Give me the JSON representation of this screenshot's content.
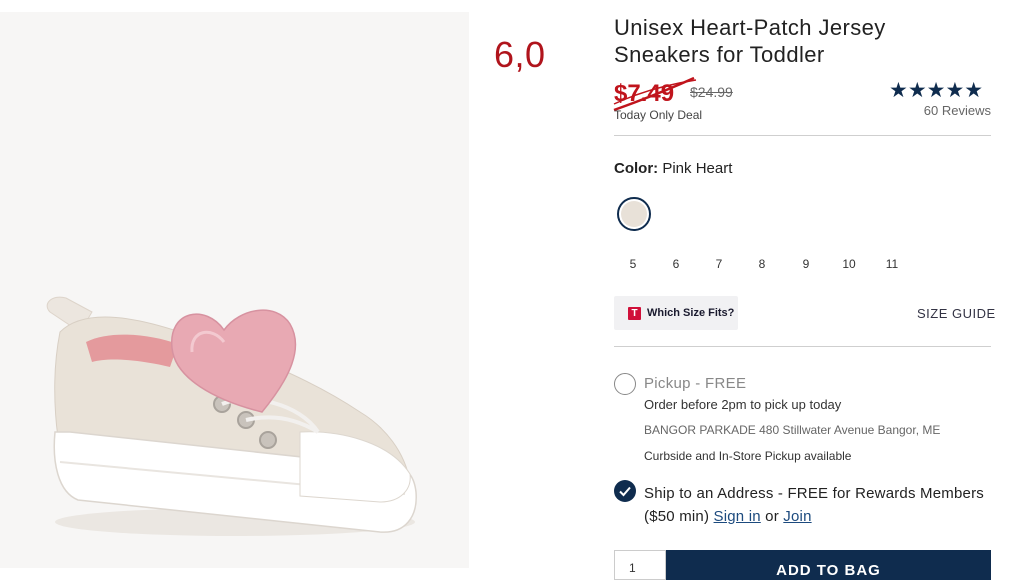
{
  "overlay_number": "6,0",
  "product": {
    "title": "Unisex Heart-Patch Jersey Sneakers for Toddler",
    "price_now": "$7.49",
    "price_was": "$24.99",
    "deal_label": "Today Only Deal",
    "rating_stars": "★★★★★",
    "rating": 5,
    "reviews": "60 Reviews",
    "color_label": "Color:",
    "color_value": "Pink Heart",
    "sizes": [
      "5",
      "6",
      "7",
      "8",
      "9",
      "10",
      "11"
    ],
    "fit_badge": "T",
    "fit_label": "Which Size Fits?",
    "size_guide": "SIZE GUIDE"
  },
  "fulfillment": {
    "pickup_title": "Pickup - FREE",
    "pickup_sub": "Order before 2pm to pick up today",
    "store": "BANGOR PARKADE 480 Stillwater Avenue  Bangor, ME",
    "curbside": "Curbside and In-Store Pickup available",
    "ship_text": "Ship to an Address - FREE for Rewards Members ($50 min)",
    "sign_in": "Sign in",
    "or": "or",
    "join": "Join"
  },
  "cart": {
    "qty": "1",
    "add_label": "ADD TO BAG"
  },
  "colors": {
    "navy": "#0f2c4e",
    "sale_red": "#c0141c",
    "swatch": "#e8e1d8"
  }
}
